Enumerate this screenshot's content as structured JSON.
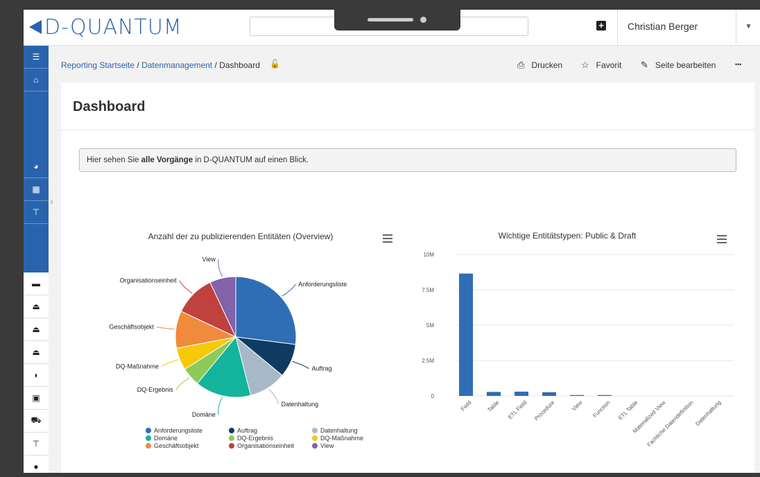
{
  "app": {
    "logo_text": "D-QUANTUM",
    "user_name": "Christian Berger"
  },
  "breadcrumb": {
    "links": [
      "Reporting Startseite",
      "Datenmanagement"
    ],
    "separator": " / ",
    "current": "Dashboard"
  },
  "actions": {
    "print": "Drucken",
    "favorite": "Favorit",
    "edit": "Seite bearbeiten",
    "more": "•••"
  },
  "page": {
    "title": "Dashboard"
  },
  "info": {
    "prefix": "Hier sehen Sie ",
    "bold": "alle Vorgänge",
    "suffix": " in D-QUANTUM auf einen Blick."
  },
  "sidebar": {
    "icons": [
      "menu-icon",
      "home-icon",
      "pie-chart-icon",
      "table-icon",
      "sitemap-icon",
      "book-icon",
      "inbox-icon",
      "inbox-icon",
      "inbox-icon",
      "shield-icon",
      "clipboard-icon",
      "cart-icon",
      "sitemap-icon",
      "user-circle-icon"
    ]
  },
  "colors": {
    "accent": "#2a63ad"
  },
  "chart_data": [
    {
      "type": "pie",
      "title": "Anzahl der zu publizierenden Entitäten (Overview)",
      "slices": [
        {
          "label": "Anforderungsliste",
          "value": 27,
          "color": "#2f6db5"
        },
        {
          "label": "Auftrag",
          "value": 9,
          "color": "#0f3b63"
        },
        {
          "label": "Datenhaltung",
          "value": 10,
          "color": "#a7b9c8"
        },
        {
          "label": "Domäne",
          "value": 15,
          "color": "#14b39b"
        },
        {
          "label": "DQ-Ergebnis",
          "value": 5,
          "color": "#8ccb5a"
        },
        {
          "label": "DQ-Maßnahme",
          "value": 6,
          "color": "#f7c90b"
        },
        {
          "label": "Geschäftsobjekt",
          "value": 10,
          "color": "#f08a3c"
        },
        {
          "label": "Organisationseinheit",
          "value": 11,
          "color": "#c0413e"
        },
        {
          "label": "View",
          "value": 7,
          "color": "#8262a8"
        }
      ],
      "legend": "bottom"
    },
    {
      "type": "bar",
      "title": "Wichtige Entitätstypen: Public & Draft",
      "categories": [
        "Field",
        "Table",
        "ETL Field",
        "Procedure",
        "View",
        "Function",
        "ETL Table",
        "Materialized View",
        "Fachliche Datendefinition",
        "Datenhaltung"
      ],
      "values": [
        8650000,
        280000,
        300000,
        260000,
        60000,
        60000,
        0,
        0,
        0,
        0
      ],
      "ylim": [
        0,
        10000000
      ],
      "yticks": [
        "0",
        "2.5M",
        "5M",
        "7.5M",
        "10M"
      ],
      "ytick_values": [
        0,
        2500000,
        5000000,
        7500000,
        10000000
      ],
      "color": "#2f6db5",
      "grid": true
    }
  ]
}
